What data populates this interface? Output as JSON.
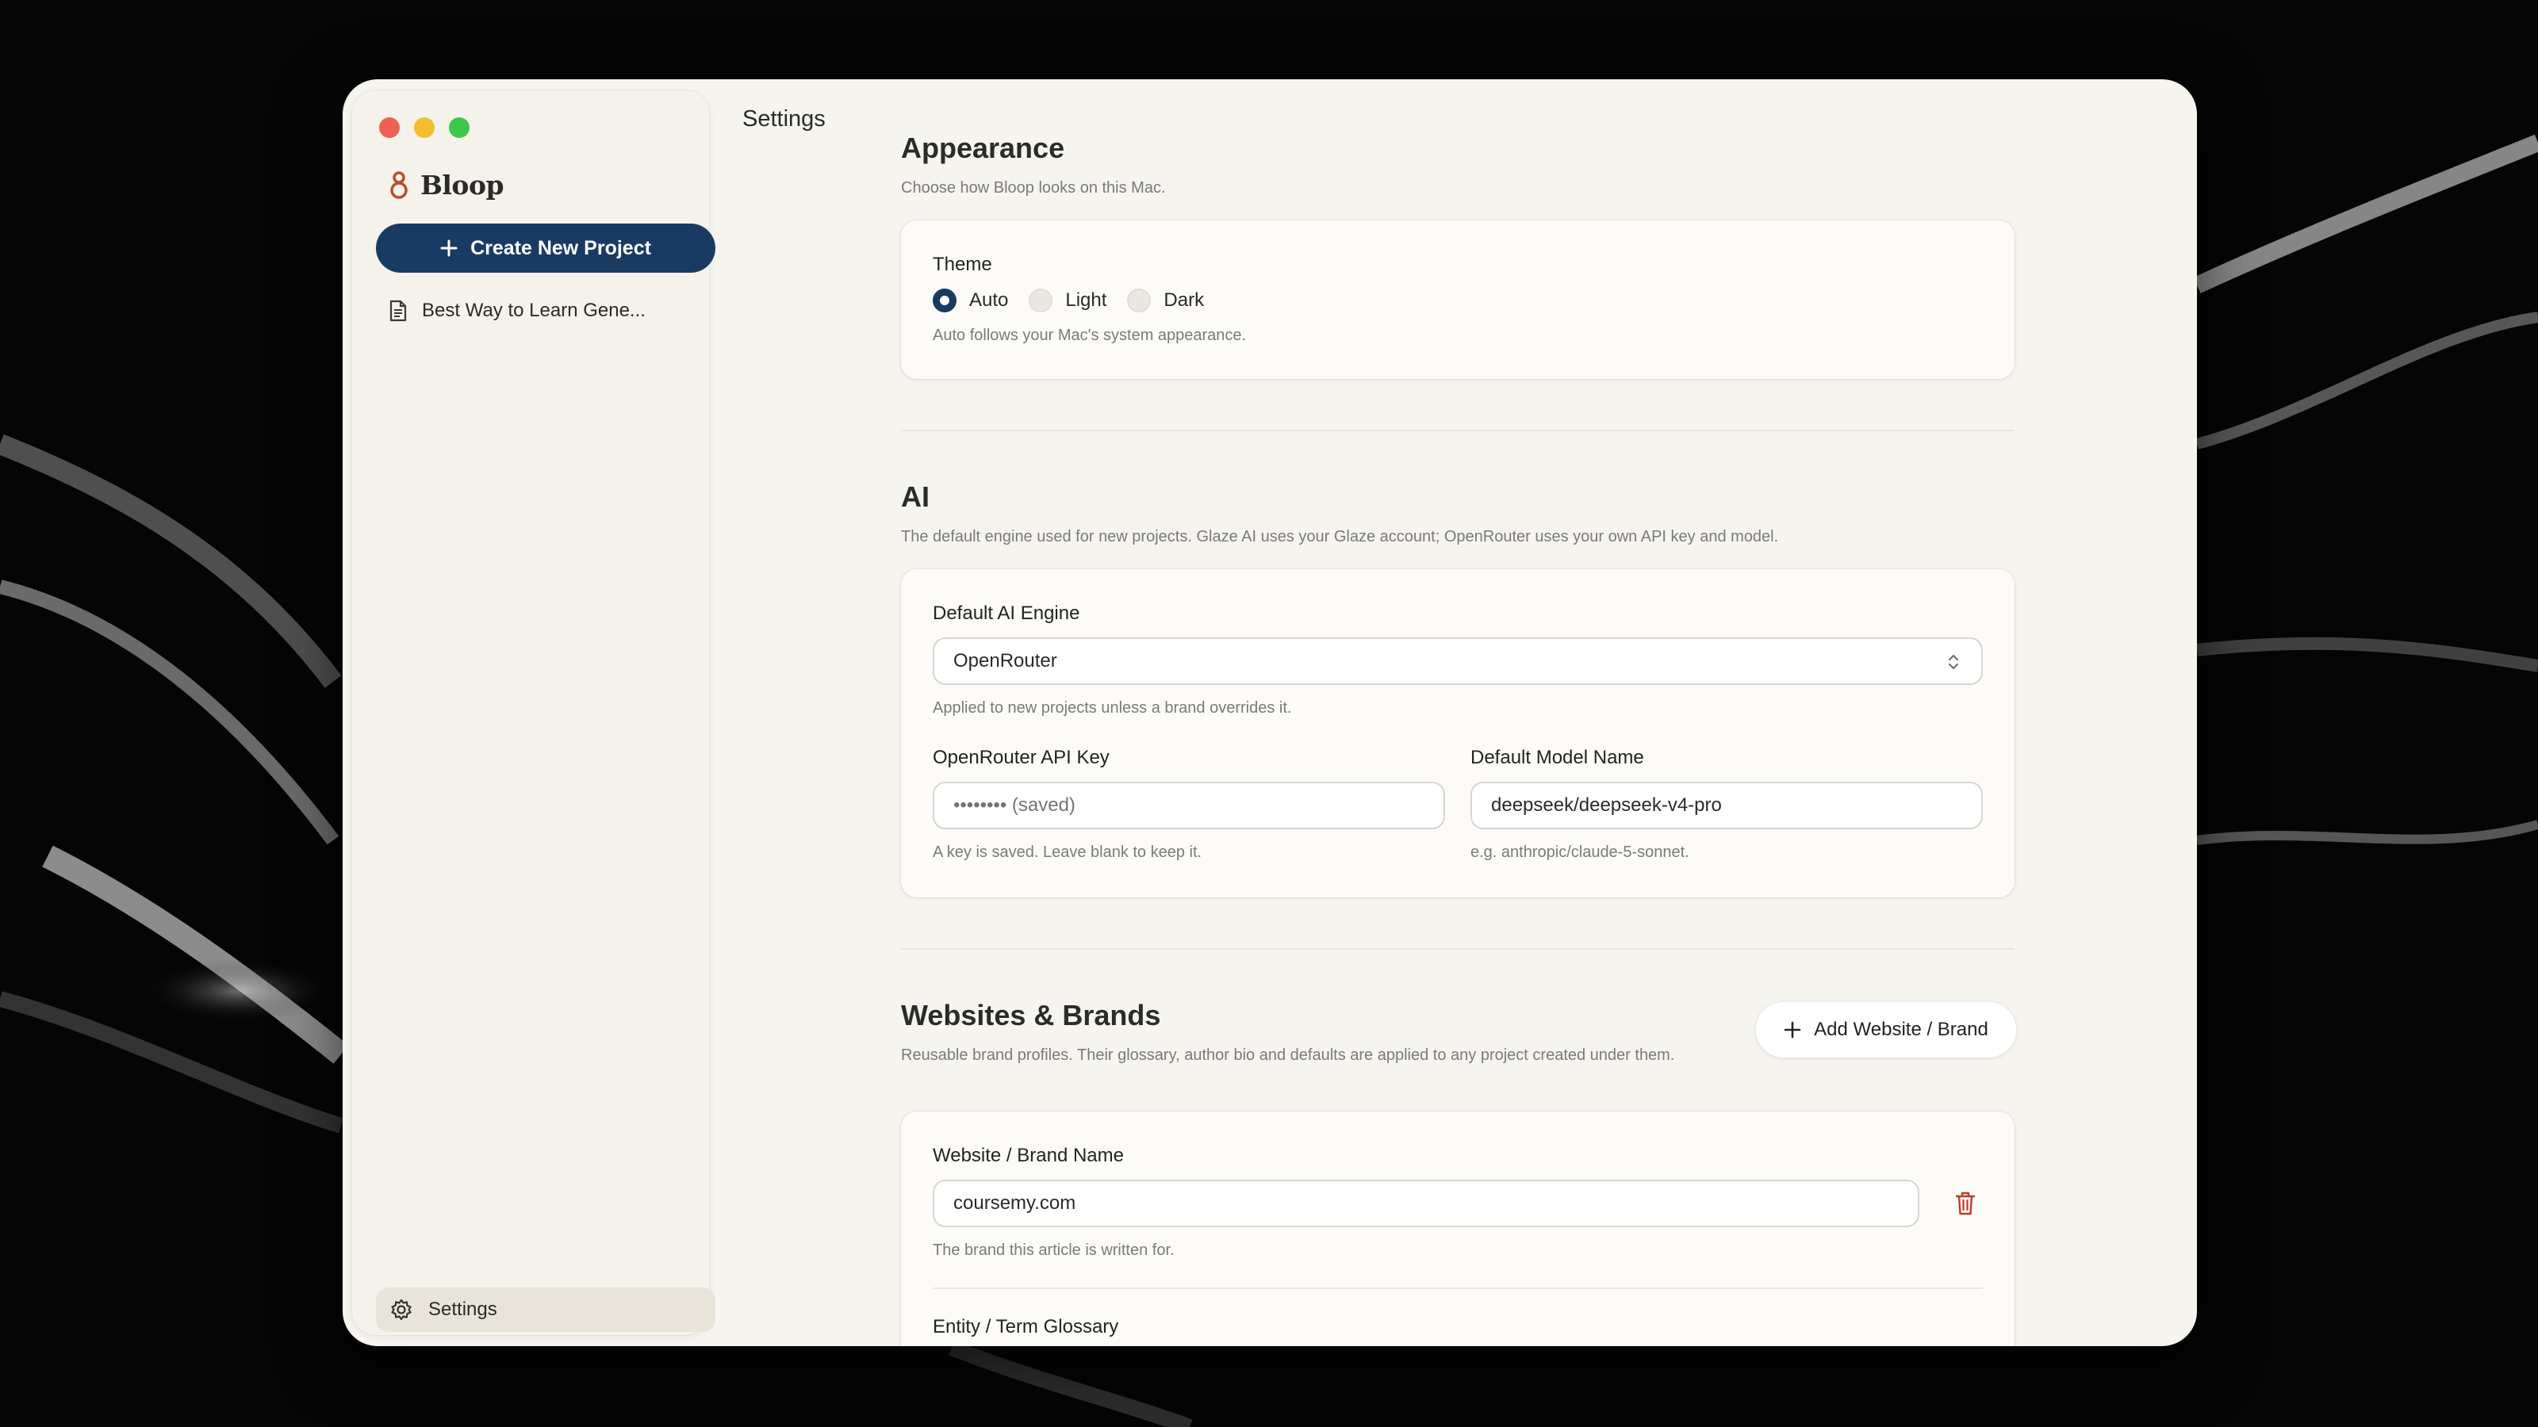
{
  "window": {
    "title": "Settings"
  },
  "sidebar": {
    "brand": "Bloop",
    "create_button": "Create New Project",
    "projects": [
      "Best Way to Learn Gene..."
    ],
    "settings_label": "Settings"
  },
  "appearance": {
    "title": "Appearance",
    "description": "Choose how Bloop looks on this Mac.",
    "theme_label": "Theme",
    "options": [
      "Auto",
      "Light",
      "Dark"
    ],
    "selected": "Auto",
    "help": "Auto follows your Mac's system appearance."
  },
  "ai": {
    "title": "AI",
    "description": "The default engine used for new projects. Glaze AI uses your Glaze account; OpenRouter uses your own API key and model.",
    "engine_label": "Default AI Engine",
    "engine_value": "OpenRouter",
    "engine_help": "Applied to new projects unless a brand overrides it.",
    "api_key_label": "OpenRouter API Key",
    "api_key_placeholder": "•••••••• (saved)",
    "api_key_help": "A key is saved. Leave blank to keep it.",
    "model_label": "Default Model Name",
    "model_value": "deepseek/deepseek-v4-pro",
    "model_help": "e.g. anthropic/claude-5-sonnet."
  },
  "brands": {
    "title": "Websites & Brands",
    "description": "Reusable brand profiles. Their glossary, author bio and defaults are applied to any project created under them.",
    "add_button": "Add Website / Brand",
    "name_label": "Website / Brand Name",
    "name_value": "coursemy.com",
    "name_help": "The brand this article is written for.",
    "glossary_label": "Entity / Term Glossary"
  },
  "colors": {
    "accent": "#193b63",
    "danger": "#c0392b",
    "window_bg": "#f6f4ee",
    "brand_logo": "#b5502e"
  },
  "icons": [
    "logo-icon",
    "plus-icon",
    "document-icon",
    "gear-icon",
    "chevron-updown-icon",
    "trash-icon"
  ]
}
